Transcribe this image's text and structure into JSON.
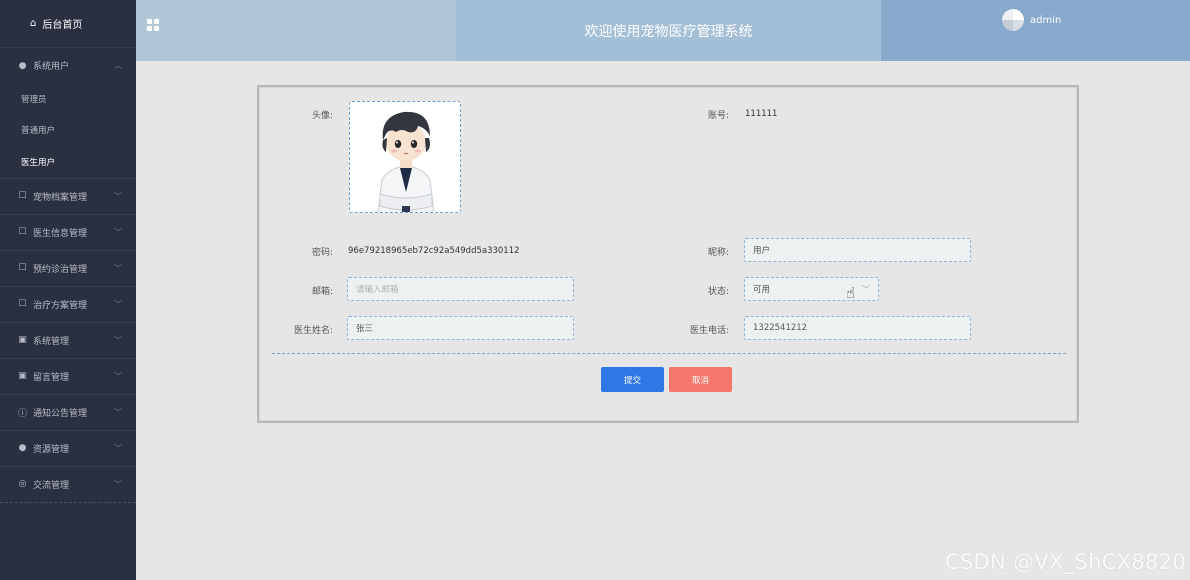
{
  "sidebar": {
    "home": "后台首页",
    "groups": [
      {
        "label": "系统用户",
        "icon": "user-icon",
        "sub": [
          "管理员",
          "普通用户",
          "医生用户"
        ],
        "active_sub": 2
      },
      {
        "label": "宠物档案管理",
        "icon": "folder-icon"
      },
      {
        "label": "医生信息管理",
        "icon": "folder-icon"
      },
      {
        "label": "预约诊治管理",
        "icon": "folder-icon"
      },
      {
        "label": "治疗方案管理",
        "icon": "folder-icon"
      },
      {
        "label": "系统管理",
        "icon": "picture-icon"
      },
      {
        "label": "留言管理",
        "icon": "picture-icon"
      },
      {
        "label": "通知公告管理",
        "icon": "info-icon"
      },
      {
        "label": "资源管理",
        "icon": "location-icon"
      },
      {
        "label": "交流管理",
        "icon": "chat-icon"
      }
    ]
  },
  "header": {
    "title": "欢迎使用宠物医疗管理系统",
    "user": "admin"
  },
  "form": {
    "avatar_label": "头像:",
    "account_label": "账号:",
    "account_value": "111111",
    "password_label": "密码:",
    "password_value": "96e79218965eb72c92a549dd5a330112",
    "nickname_label": "昵称:",
    "nickname_value": "用户",
    "email_label": "邮箱:",
    "email_placeholder": "请输入邮箱",
    "status_label": "状态:",
    "status_value": "可用",
    "name_label": "医生姓名:",
    "name_value": "张三",
    "phone_label": "医生电话:",
    "phone_value": "1322541212",
    "submit": "提交",
    "cancel": "取消"
  },
  "watermark": "CSDN @VX_ShCX8820",
  "colors": {
    "sidebar_bg": "#2b3040",
    "header_left": "#b2c5d6",
    "header_mid": "#a3bfd6",
    "header_right": "#86a9cc",
    "submit": "#2e78e6",
    "cancel": "#f5776b"
  }
}
